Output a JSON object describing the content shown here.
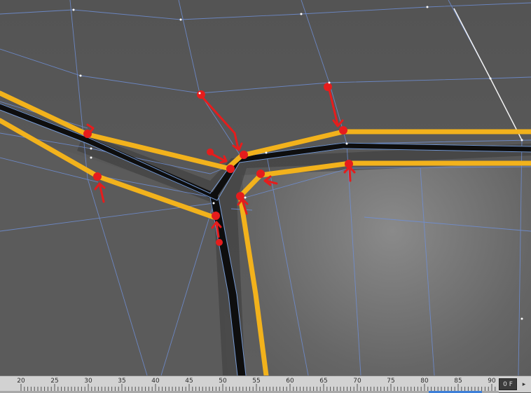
{
  "viewport": {
    "background": "#5a5a5a",
    "mesh_wire_color": "#6f8fd6",
    "highlight_color": "#f2b21c",
    "annotation_color": "#e51d1d",
    "edge_color": "#101010"
  },
  "timeline": {
    "ticks": [
      "20",
      "25",
      "30",
      "35",
      "40",
      "45",
      "50",
      "55",
      "60",
      "65",
      "70",
      "75",
      "80",
      "85",
      "90"
    ],
    "frame_readout": "0 F",
    "nav_icon": "arrow-right-icon"
  }
}
